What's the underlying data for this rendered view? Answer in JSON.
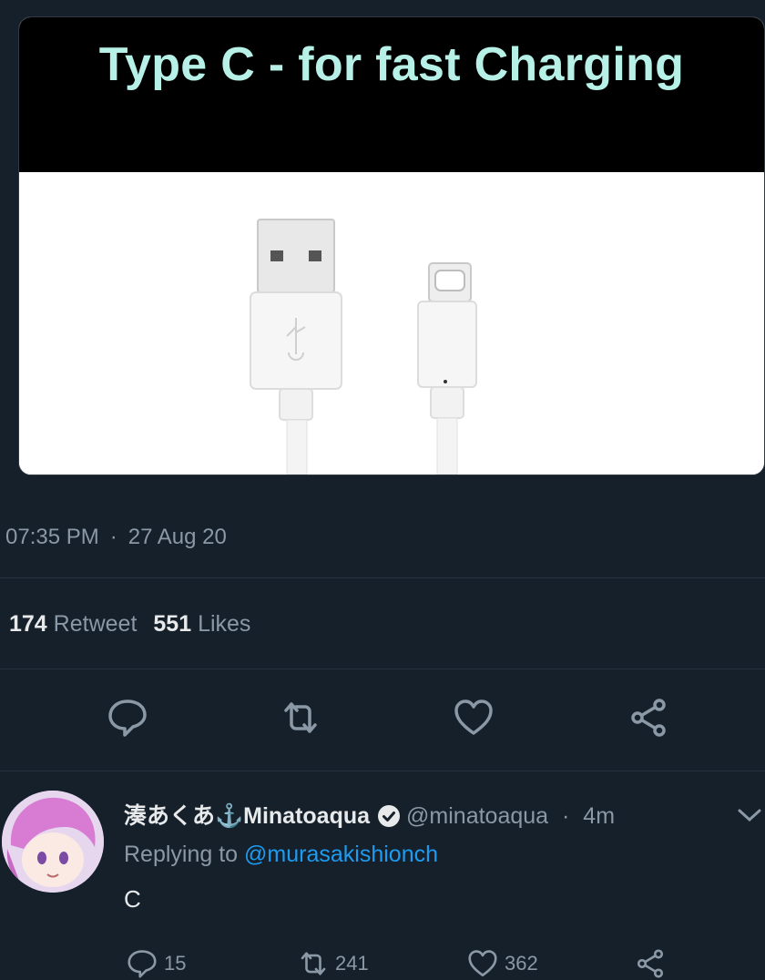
{
  "tweet": {
    "media_title": "Type C - for fast Charging",
    "time": "07:35 PM",
    "separator": "·",
    "date": "27 Aug 20",
    "retweet_count": "174",
    "retweet_label": "Retweet",
    "like_count": "551",
    "like_label": "Likes",
    "actions": [
      "reply-icon",
      "retweet-icon",
      "like-icon",
      "share-icon"
    ]
  },
  "reply": {
    "display_name": "湊あくあ⚓Minatoaqua",
    "handle": "@minatoaqua",
    "separator": "·",
    "time": "4m",
    "replying_prefix": "Replying to",
    "replying_to": "@murasakishionch",
    "text": "C",
    "reply_count": "15",
    "retweet_count": "241",
    "like_count": "362"
  },
  "colors": {
    "background": "#15202b",
    "accent": "#1d9bf0",
    "muted": "#8b98a5",
    "title_tint": "#b6f0e6"
  }
}
